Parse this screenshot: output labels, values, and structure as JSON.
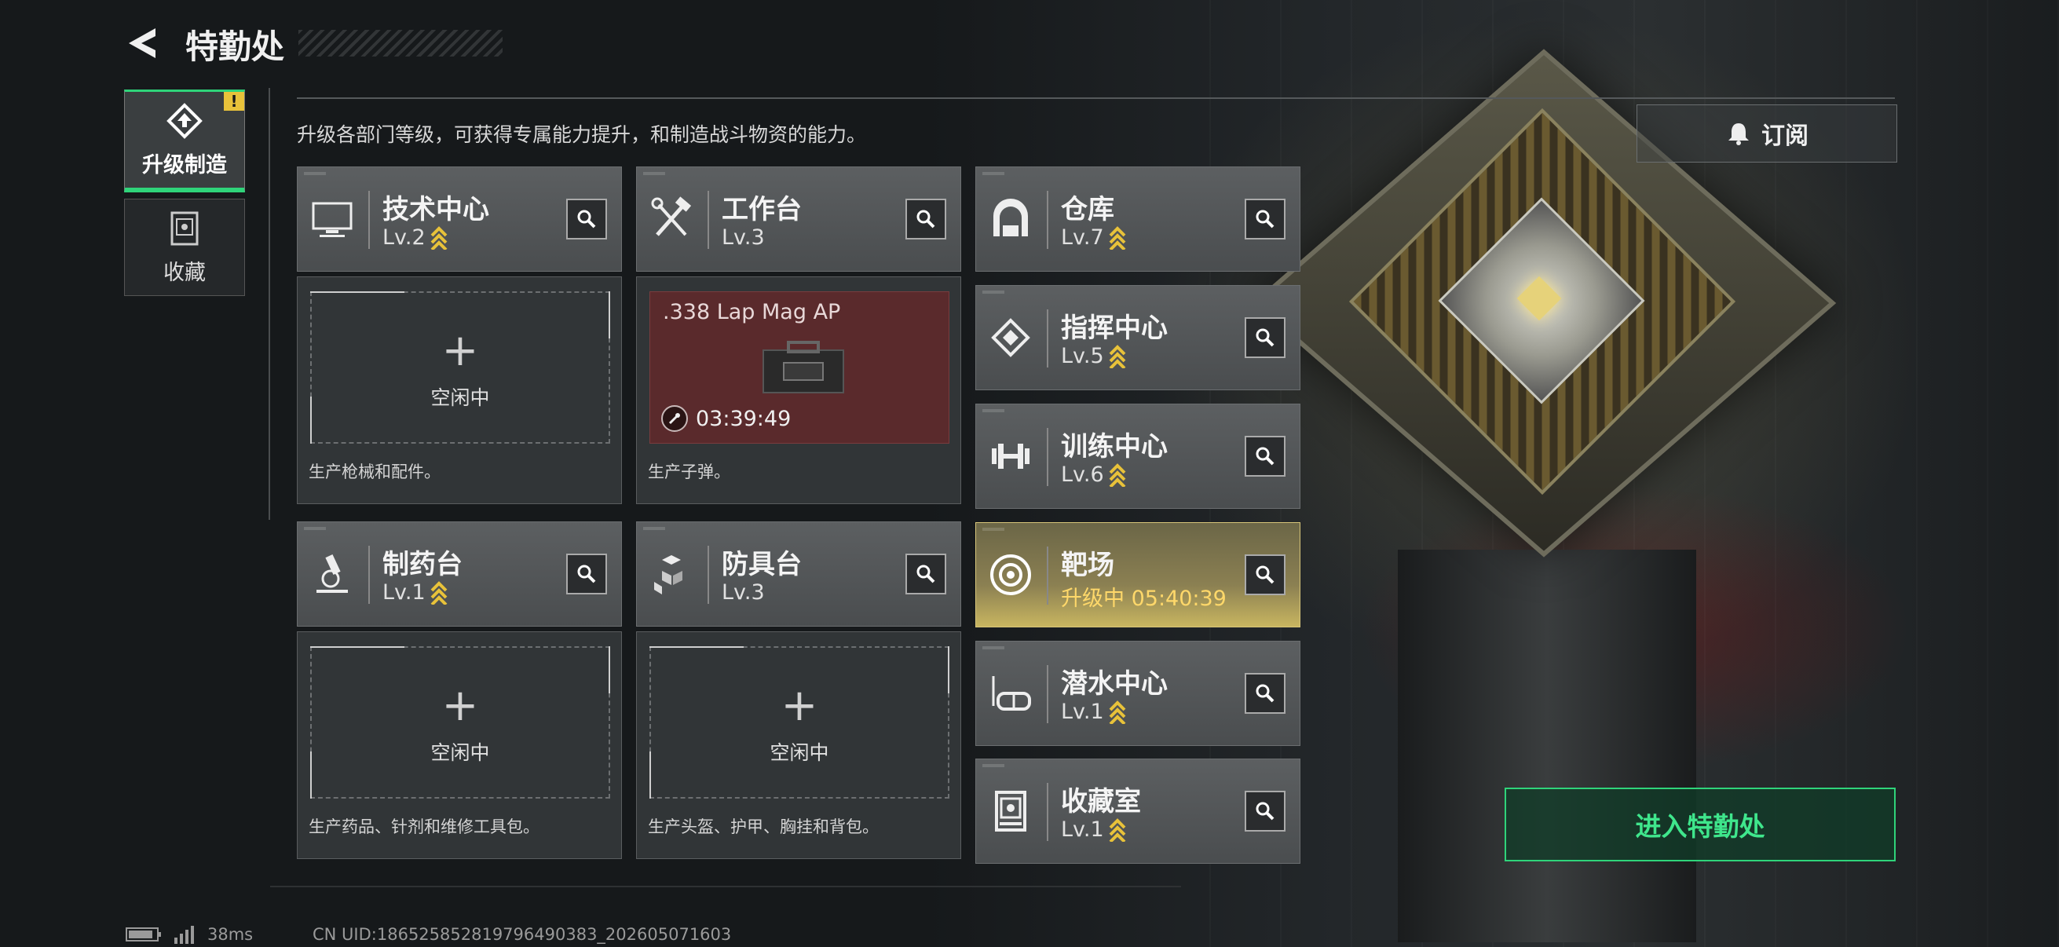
{
  "header": {
    "title": "特勤处"
  },
  "tabs": [
    {
      "label": "升级制造",
      "active": true,
      "alert": "!"
    },
    {
      "label": "收藏",
      "active": false
    }
  ],
  "description": "升级各部门等级，可获得专属能力提升，和制造战斗物资的能力。",
  "subscribe": {
    "label": "订阅"
  },
  "departments": {
    "tech": {
      "name": "技术中心",
      "level": "Lv.2",
      "upgradable": true,
      "icon": "monitor-icon"
    },
    "workbench": {
      "name": "工作台",
      "level": "Lv.3",
      "upgradable": false,
      "icon": "hammer-wrench-icon"
    },
    "warehouse": {
      "name": "仓库",
      "level": "Lv.7",
      "upgradable": true,
      "icon": "warehouse-icon"
    },
    "command": {
      "name": "指挥中心",
      "level": "Lv.5",
      "upgradable": true,
      "icon": "chip-icon"
    },
    "training": {
      "name": "训练中心",
      "level": "Lv.6",
      "upgradable": true,
      "icon": "dumbbell-icon"
    },
    "pharmacy": {
      "name": "制药台",
      "level": "Lv.1",
      "upgradable": true,
      "icon": "microscope-icon"
    },
    "armor": {
      "name": "防具台",
      "level": "Lv.3",
      "upgradable": false,
      "icon": "cubes-icon"
    },
    "range": {
      "name": "靶场",
      "level": "升级中 05:40:39",
      "upgrading": true,
      "icon": "target-icon"
    },
    "diving": {
      "name": "潜水中心",
      "level": "Lv.1",
      "upgradable": true,
      "icon": "diving-mask-icon"
    },
    "collection": {
      "name": "收藏室",
      "level": "Lv.1",
      "upgradable": true,
      "icon": "collection-icon"
    }
  },
  "production": {
    "tech": {
      "status": "空闲中",
      "description": "生产枪械和配件。"
    },
    "workbench": {
      "item": ".338 Lap Mag AP",
      "timer": "03:39:49",
      "description": "生产子弹。"
    },
    "pharmacy": {
      "status": "空闲中",
      "description": "生产药品、针剂和维修工具包。"
    },
    "armor": {
      "status": "空闲中",
      "description": "生产头盔、护甲、胸挂和背包。"
    }
  },
  "enter_button": {
    "label": "进入特勤处"
  },
  "status": {
    "ping": "38ms",
    "uid": "CN UID:18652585281979649038​3_202605071603"
  },
  "colors": {
    "accent": "#2fd47a",
    "upgrade_gold": "#e8c23a",
    "upgrading_text": "#ffd86a"
  }
}
